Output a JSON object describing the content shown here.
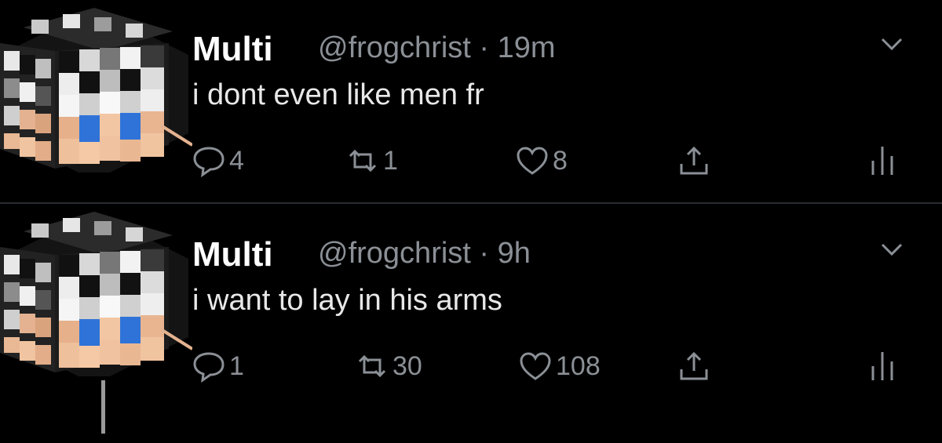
{
  "tweets": [
    {
      "name": "Multi",
      "handle": "@frogchrist",
      "time": "19m",
      "handle_line": "@frogchrist · 19m",
      "text": "i dont even like men fr",
      "replies": "4",
      "retweets": "1",
      "likes": "8"
    },
    {
      "name": "Multi",
      "handle": "@frogchrist",
      "time": "9h",
      "handle_line": "@frogchrist · 9h",
      "text": "i want to lay in his arms",
      "replies": "1",
      "retweets": "30",
      "likes": "108"
    }
  ],
  "icons": {
    "reply": "reply-icon",
    "retweet": "retweet-icon",
    "like": "heart-icon",
    "share": "share-icon",
    "analytics": "analytics-icon",
    "more": "chevron-down-icon"
  },
  "colors": {
    "background": "#000000",
    "secondary_text": "#8b9096",
    "divider": "#2a2d31"
  }
}
